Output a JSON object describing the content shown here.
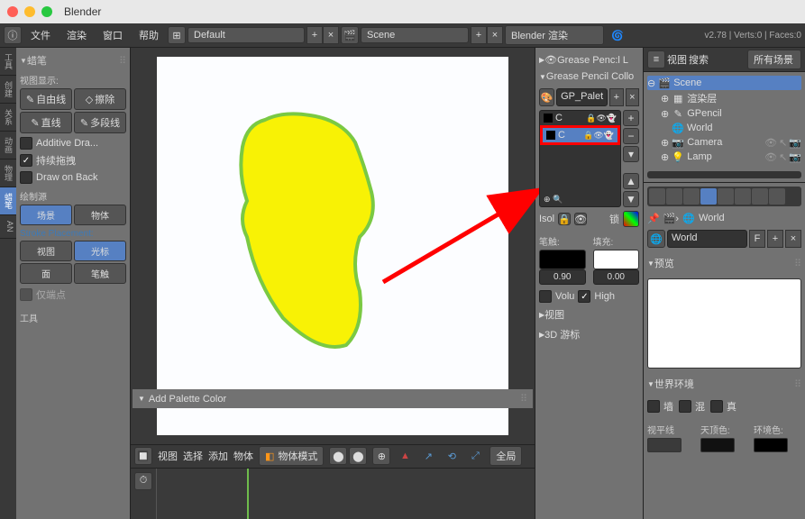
{
  "title": "Blender",
  "topmenu": {
    "file": "文件",
    "render": "渲染",
    "window": "窗口",
    "help": "帮助",
    "layout": "Default",
    "scene": "Scene",
    "engine": "Blender 渲染",
    "stats": "v2.78 | Verts:0 | Faces:0"
  },
  "vtabs": [
    "工具",
    "创建",
    "关系",
    "动画",
    "物理",
    "蜡笔",
    "AN"
  ],
  "left": {
    "pencil": "蜡笔",
    "viewdisp": "视图显示:",
    "freeline": "自由线",
    "erase": "擦除",
    "line": "直线",
    "poly": "多段线",
    "additive": "Additive Dra...",
    "drag": "持续拖拽",
    "dob": "Draw on Back",
    "drawsrc": "绘制源",
    "scene": "场景",
    "obj": "物体",
    "stroke": "Stroke Placement:",
    "view": "视图",
    "cursor": "光标",
    "face": "面",
    "brush": "笔触",
    "tips": "仅端点",
    "tools": "工具"
  },
  "addpal": "Add Palette Color",
  "tlhdr": {
    "view": "视图",
    "select": "选择",
    "add": "添加",
    "obj": "物体",
    "mode": "物体模式",
    "global": "全局"
  },
  "r1": {
    "gp": "Grease Penc:l L",
    "gpc": "Grease Pencil Collo",
    "palette": "GP_Palet",
    "colC": "C",
    "iso": "Isol",
    "lock": "锁",
    "stroke": "笔触:",
    "fill": "填充:",
    "sv": "0.90",
    "fv": "0.00",
    "volu": "Volu",
    "high": "High",
    "view": "视图",
    "3d": "3D 游标"
  },
  "r2": {
    "view": "视图",
    "search": "搜索",
    "all": "所有场景",
    "scene": "Scene",
    "renderlayer": "渲染层",
    "gpencil": "GPencil",
    "world": "World",
    "camera": "Camera",
    "lamp": "Lamp",
    "worldhdr": "World",
    "world2": "World",
    "f": "F",
    "preview": "预览",
    "worldenv": "世界环境",
    "wall": "墙",
    "mix": "混",
    "real": "真",
    "horizon": "视平线",
    "zenith": "天顶色:",
    "ambient": "环境色:"
  }
}
